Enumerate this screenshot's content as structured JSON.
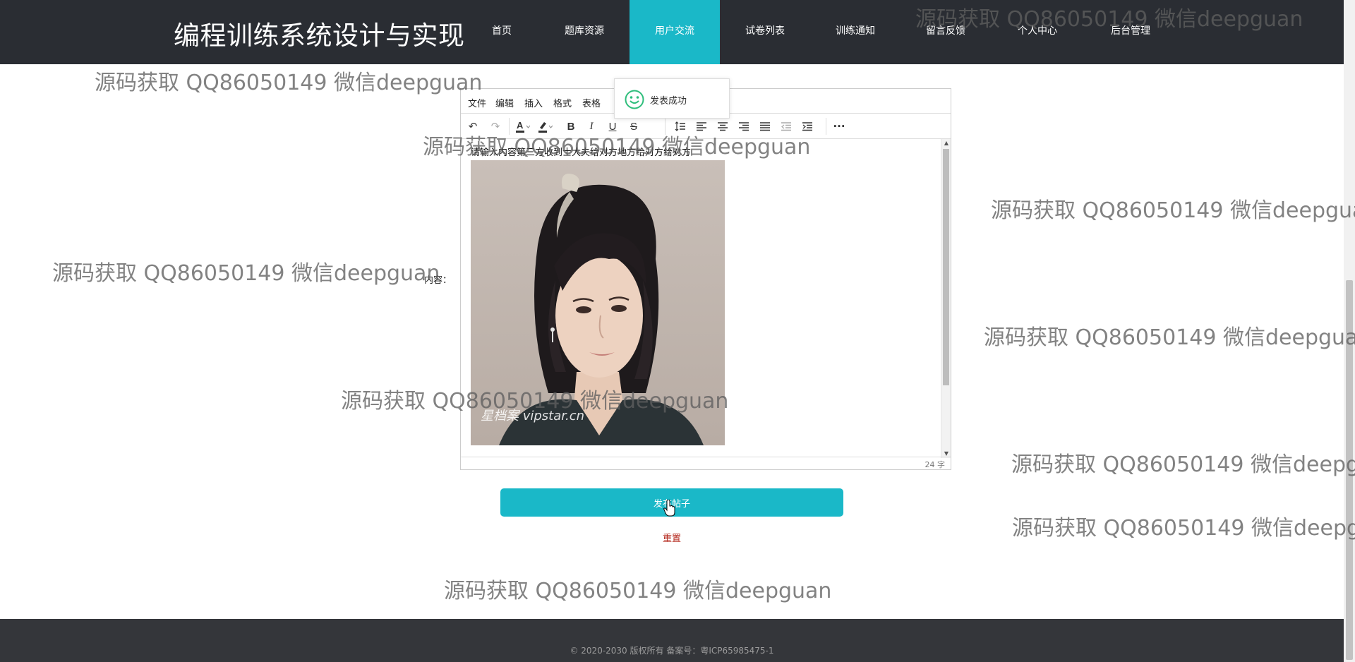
{
  "header": {
    "site_title": "编程训练系统设计与实现",
    "nav": [
      "首页",
      "题库资源",
      "用户交流",
      "试卷列表",
      "训练通知",
      "留言反馈",
      "个人中心",
      "后台管理"
    ],
    "active_nav_index": 2
  },
  "form": {
    "content_label": "内容：",
    "submit_label": "发布帖子",
    "reset_label": "重置"
  },
  "editor": {
    "menu": [
      "文件",
      "编辑",
      "插入",
      "格式",
      "表格"
    ],
    "toolbar_icons": [
      "undo-icon",
      "redo-icon",
      "text-color-icon",
      "highlight-color-icon",
      "bold-icon",
      "italic-icon",
      "underline-icon",
      "strikethrough-icon",
      "line-height-icon",
      "align-left-icon",
      "align-center-icon",
      "align-right-icon",
      "justify-icon",
      "outdent-icon",
      "indent-icon",
      "more-icon"
    ],
    "content_text": "请输入内容第三方收到士大夫给对方地方给对方给对方",
    "image_caption": "星档案 vipstar.cn",
    "word_count": "24 字"
  },
  "toast": {
    "message": "发表成功",
    "icon": "smile-icon"
  },
  "footer": {
    "copyright": "© 2020-2030 版权所有 备案号：粤ICP65985475-1"
  },
  "watermark": {
    "text": "源码获取 QQ86050149 微信deepguan"
  },
  "colors": {
    "header_bg": "#2a2d33",
    "accent": "#1ab8c8",
    "reset_text": "#b52a1f",
    "footer_bg": "#34363a",
    "toast_icon": "#2ebd7b"
  }
}
